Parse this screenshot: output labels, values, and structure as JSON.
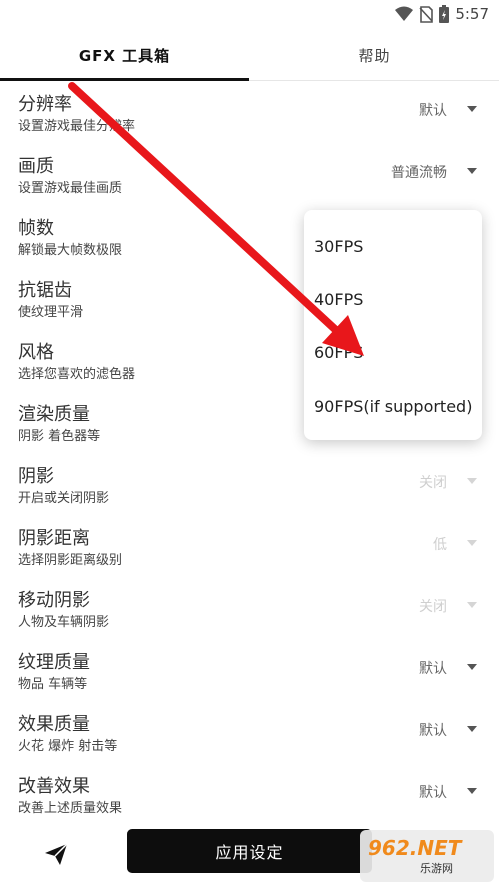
{
  "status_bar": {
    "time": "5:57",
    "icons": [
      "wifi-icon",
      "no-sim-icon",
      "battery-charging-icon"
    ]
  },
  "tabs": [
    {
      "label": "GFX 工具箱",
      "active": true
    },
    {
      "label": "帮助",
      "active": false
    }
  ],
  "settings": [
    {
      "title": "分辨率",
      "subtitle": "设置游戏最佳分辨率",
      "value": "默认",
      "enabled": true
    },
    {
      "title": "画质",
      "subtitle": "设置游戏最佳画质",
      "value": "普通流畅",
      "enabled": true
    },
    {
      "title": "帧数",
      "subtitle": "解锁最大帧数极限",
      "value": "",
      "enabled": true
    },
    {
      "title": "抗锯齿",
      "subtitle": "使纹理平滑",
      "value": "",
      "enabled": true
    },
    {
      "title": "风格",
      "subtitle": "选择您喜欢的滤色器",
      "value": "",
      "enabled": true
    },
    {
      "title": "渲染质量",
      "subtitle": "阴影 着色器等",
      "value": "",
      "enabled": true
    },
    {
      "title": "阴影",
      "subtitle": "开启或关闭阴影",
      "value": "关闭",
      "enabled": false
    },
    {
      "title": "阴影距离",
      "subtitle": "选择阴影距离级别",
      "value": "低",
      "enabled": false
    },
    {
      "title": "移动阴影",
      "subtitle": "人物及车辆阴影",
      "value": "关闭",
      "enabled": false
    },
    {
      "title": "纹理质量",
      "subtitle": "物品 车辆等",
      "value": "默认",
      "enabled": true
    },
    {
      "title": "效果质量",
      "subtitle": "火花 爆炸 射击等",
      "value": "默认",
      "enabled": true
    },
    {
      "title": "改善效果",
      "subtitle": "改善上述质量效果",
      "value": "默认",
      "enabled": true
    }
  ],
  "fps_dropdown": {
    "options": [
      "30FPS",
      "40FPS",
      "60FPS",
      "90FPS(if supported)"
    ]
  },
  "bottom_bar": {
    "apply_label": "应用设定",
    "send_icon": "send-icon"
  },
  "watermark": {
    "brand": "962.NET",
    "sub": "乐游网"
  },
  "colors": {
    "annotation_arrow": "#e8171b",
    "apply_button": "#0d0d0d"
  }
}
